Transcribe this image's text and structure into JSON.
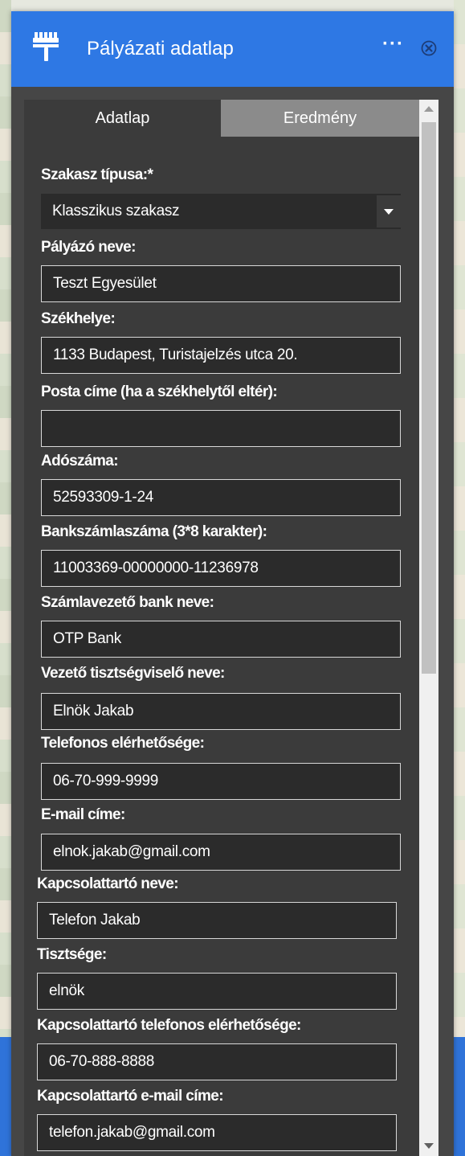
{
  "window": {
    "title": "Pályázati adatlap",
    "more_label": "···",
    "app_icon": "paint-roller-icon",
    "close_icon": "close-circle-icon",
    "header_color": "#2e78e4"
  },
  "tabs": [
    {
      "label": "Adatlap",
      "active": true
    },
    {
      "label": "Eredmény",
      "active": false
    }
  ],
  "form": {
    "section_type": {
      "label": "Szakasz típusa:*",
      "value": "Klasszikus szakasz"
    },
    "applicant_name": {
      "label": "Pályázó neve:",
      "value": "Teszt Egyesület"
    },
    "headquarters": {
      "label": "Székhelye:",
      "value": "1133 Budapest, Turistajelzés utca 20."
    },
    "postal_address": {
      "label": "Posta címe (ha a székhelytől eltér):",
      "value": ""
    },
    "tax_number": {
      "label": "Adószáma:",
      "value": "52593309-1-24"
    },
    "bank_account": {
      "label": "Bankszámlaszáma (3*8 karakter):",
      "value": "11003369-00000000-11236978"
    },
    "bank_name": {
      "label": "Számlavezető bank neve:",
      "value": "OTP Bank"
    },
    "leader_name": {
      "label": "Vezető tisztségviselő neve:",
      "value": "Elnök Jakab"
    },
    "phone": {
      "label": "Telefonos elérhetősége:",
      "value": "06-70-999-9999"
    },
    "email": {
      "label": "E-mail címe:",
      "value": "elnok.jakab@gmail.com"
    },
    "contact_name": {
      "label": "Kapcsolattartó neve:",
      "value": "Telefon Jakab"
    },
    "contact_title": {
      "label": "Tisztsége:",
      "value": "elnök"
    },
    "contact_phone": {
      "label": "Kapcsolattartó telefonos elérhetősége:",
      "value": "06-70-888-8888"
    },
    "contact_email": {
      "label": "Kapcsolattartó e-mail címe:",
      "value": "telefon.jakab@gmail.com"
    }
  }
}
